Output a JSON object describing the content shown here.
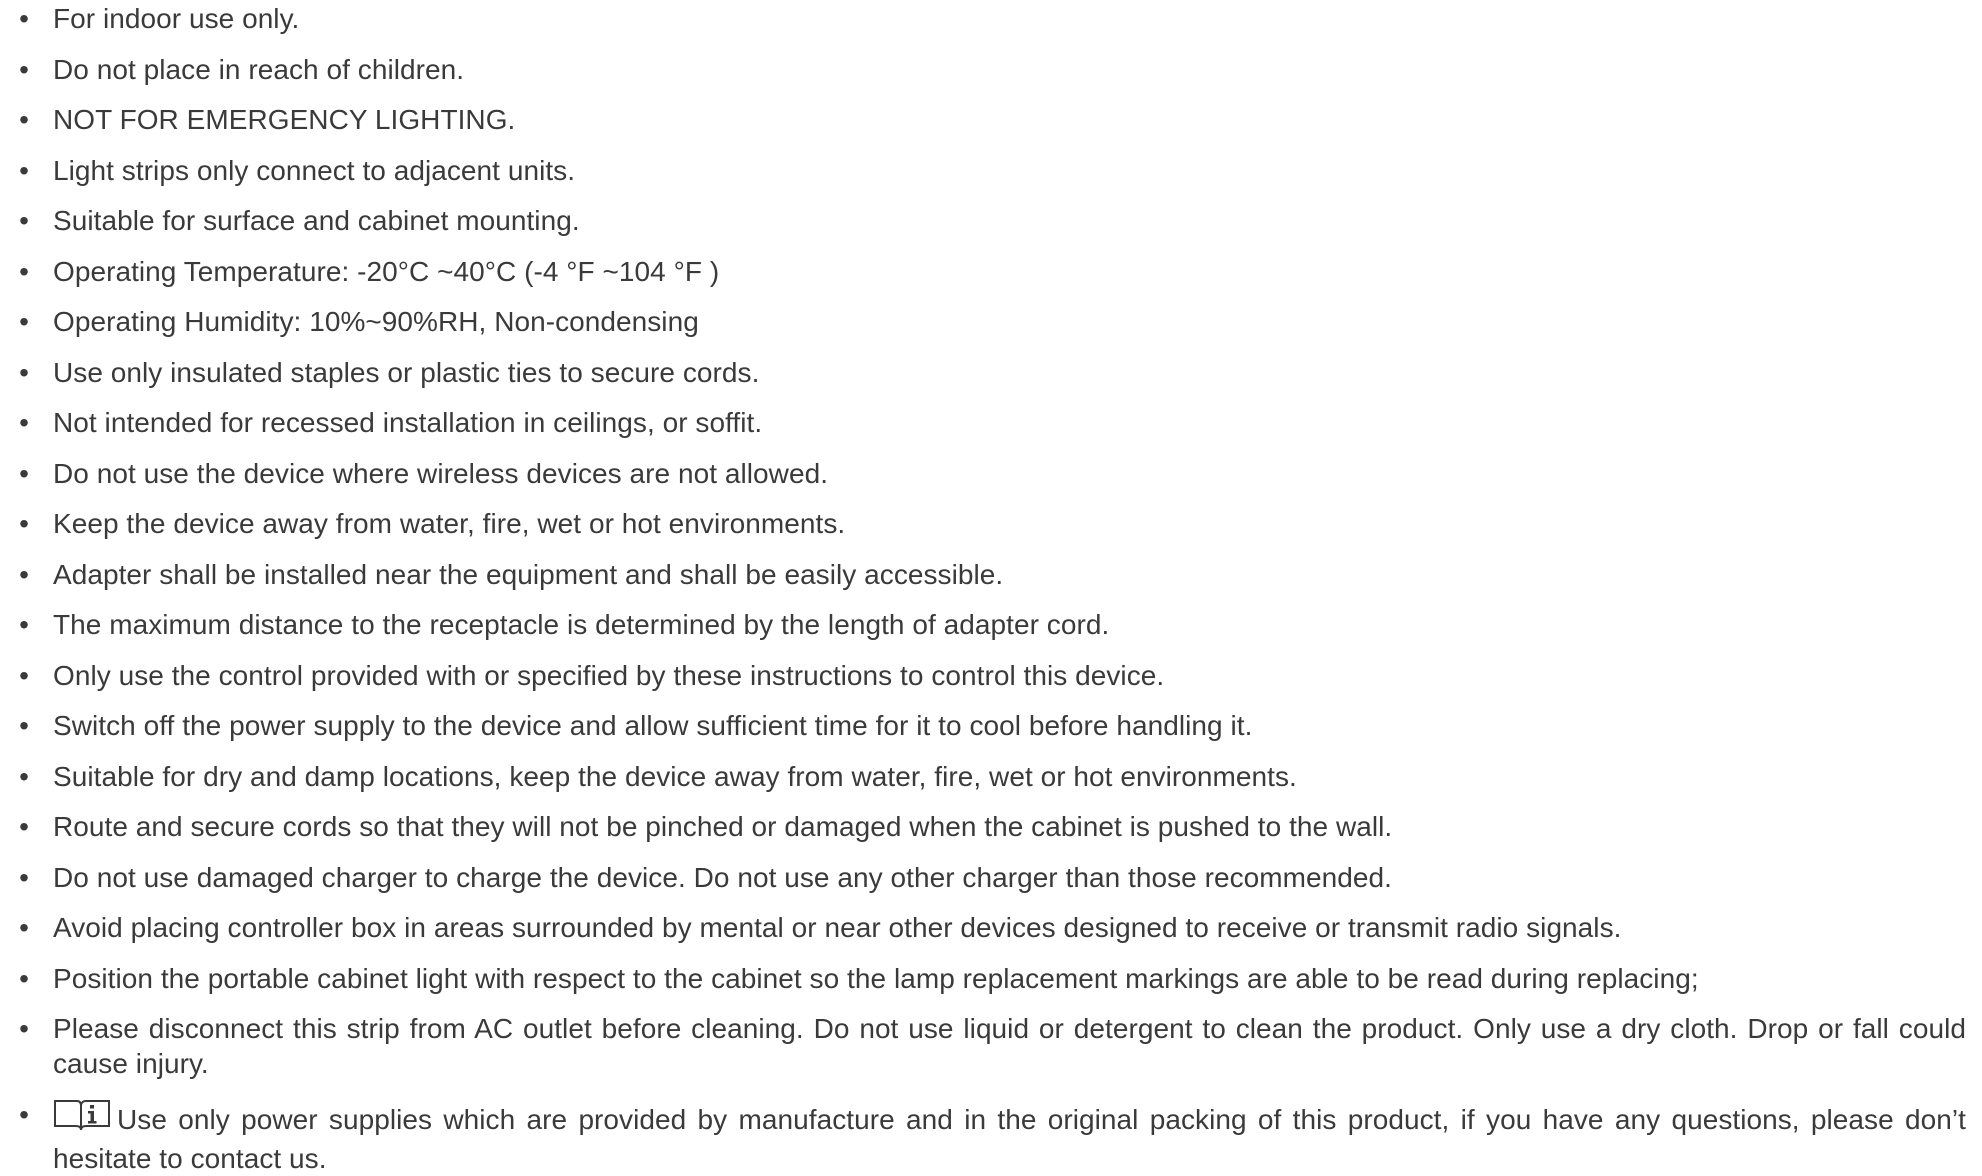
{
  "bullet_glyph": "•",
  "items": [
    "For indoor use only.",
    "Do not place in reach of children.",
    "NOT FOR EMERGENCY LIGHTING.",
    "Light strips only connect to adjacent units.",
    "Suitable for surface and cabinet mounting.",
    "Operating Temperature: -20°C ~40°C (-4 °F ~104 °F )",
    "Operating Humidity: 10%~90%RH, Non-condensing",
    "Use only insulated staples or plastic ties to secure cords.",
    "Not intended for recessed installation in ceilings, or soffit.",
    "Do not use the device where wireless devices are not allowed.",
    "Keep the device away from water, fire, wet or hot environments.",
    "Adapter shall be installed near the equipment and shall be easily accessible.",
    "The maximum distance to the receptacle is determined by the length of adapter cord.",
    "Only use the control provided with or specified by these instructions to control this device.",
    "Switch off the power supply to the device and allow sufficient time for it to cool before handling it.",
    "Suitable for dry and damp locations, keep the device away from water, fire, wet or hot environments.",
    "Route and secure cords so that they will not be pinched or damaged when the cabinet is pushed to the wall.",
    "Do not use damaged charger to charge the device. Do not use any other charger than those recommended.",
    "Avoid placing controller box in areas surrounded by mental or near other devices designed to receive or transmit radio signals.",
    "Position the portable cabinet light with respect to the cabinet so the lamp replacement markings are able to be read during replacing;",
    "Please disconnect this strip from AC outlet before cleaning. Do not use liquid or detergent to clean the product. Only use a dry cloth. Drop or fall could cause injury.",
    "Use only power supplies which are provided by manufacture and in the original packing of this product, if you have any questions, please don’t hesitate to contact us."
  ],
  "last_item_icon": "read-manual-info-icon"
}
